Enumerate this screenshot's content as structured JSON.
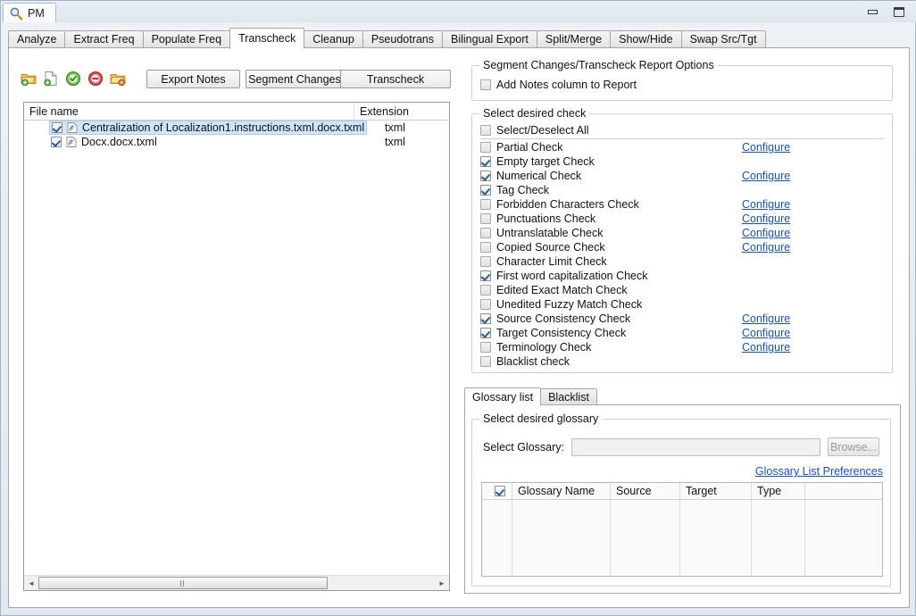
{
  "window": {
    "app_tab_label": "PM",
    "app_icon": "magnifier-icon",
    "minimize_label": "Minimize",
    "restore_label": "Restore"
  },
  "tabs": [
    {
      "label": "Analyze",
      "active": false
    },
    {
      "label": "Extract Freq",
      "active": false
    },
    {
      "label": "Populate Freq",
      "active": false
    },
    {
      "label": "Transcheck",
      "active": true
    },
    {
      "label": "Cleanup",
      "active": false
    },
    {
      "label": "Pseudotrans",
      "active": false
    },
    {
      "label": "Bilingual Export",
      "active": false
    },
    {
      "label": "Split/Merge",
      "active": false
    },
    {
      "label": "Show/Hide",
      "active": false
    },
    {
      "label": "Swap Src/Tgt",
      "active": false
    }
  ],
  "toolbar": {
    "icons": [
      {
        "name": "add-folder-icon"
      },
      {
        "name": "add-file-icon"
      },
      {
        "name": "check-all-icon"
      },
      {
        "name": "uncheck-all-icon"
      },
      {
        "name": "remove-folder-icon"
      }
    ],
    "export_notes_label": "Export Notes",
    "segment_changes_label": "Segment Changes",
    "transcheck_label": "Transcheck"
  },
  "file_list": {
    "columns": [
      "File name",
      "Extension"
    ],
    "rows": [
      {
        "checked": true,
        "name": "Centralization of Localization1.instructions.txml.docx.txml",
        "extension": "txml",
        "selected": true
      },
      {
        "checked": true,
        "name": "Docx.docx.txml",
        "extension": "txml",
        "selected": false
      }
    ],
    "scrollbar": {
      "left_arrow": "◄",
      "right_arrow": "►",
      "thumb_pct": 73
    }
  },
  "report_options": {
    "legend": "Segment Changes/Transcheck Report Options",
    "add_notes_label": "Add Notes column to Report",
    "add_notes_checked": false
  },
  "checks": {
    "legend": "Select desired check",
    "select_all_label": "Select/Deselect All",
    "select_all_checked": false,
    "configure_label": "Configure",
    "items": [
      {
        "label": "Partial Check",
        "checked": false,
        "configure": true
      },
      {
        "label": "Empty target Check",
        "checked": true,
        "configure": false
      },
      {
        "label": "Numerical Check",
        "checked": true,
        "configure": true
      },
      {
        "label": "Tag Check",
        "checked": true,
        "configure": false
      },
      {
        "label": "Forbidden Characters Check",
        "checked": false,
        "configure": true
      },
      {
        "label": "Punctuations Check",
        "checked": false,
        "configure": true
      },
      {
        "label": "Untranslatable Check",
        "checked": false,
        "configure": true
      },
      {
        "label": "Copied Source Check",
        "checked": false,
        "configure": true
      },
      {
        "label": "Character Limit Check",
        "checked": false,
        "configure": false
      },
      {
        "label": "First word capitalization Check",
        "checked": true,
        "configure": false
      },
      {
        "label": "Edited Exact Match Check",
        "checked": false,
        "configure": false
      },
      {
        "label": "Unedited Fuzzy Match Check",
        "checked": false,
        "configure": false
      },
      {
        "label": "Source Consistency Check",
        "checked": true,
        "configure": true
      },
      {
        "label": "Target Consistency Check",
        "checked": true,
        "configure": true
      },
      {
        "label": "Terminology Check",
        "checked": false,
        "configure": true
      },
      {
        "label": "Blacklist check",
        "checked": false,
        "configure": false
      }
    ]
  },
  "glossary": {
    "tabs": [
      {
        "label": "Glossary list",
        "active": true
      },
      {
        "label": "Blacklist",
        "active": false
      }
    ],
    "legend": "Select desired glossary",
    "select_label": "Select Glossary:",
    "select_value": "",
    "select_placeholder": "",
    "browse_label": "Browse...",
    "preferences_link": "Glossary List Preferences",
    "table": {
      "header_checked": true,
      "columns": [
        "Glossary Name",
        "Source",
        "Target",
        "Type"
      ],
      "rows": []
    }
  },
  "colors": {
    "link": "#1a52c4",
    "selection": "#cfe5fb",
    "panel_bg": "#ffffff",
    "chrome_bg": "#e9eef4"
  }
}
